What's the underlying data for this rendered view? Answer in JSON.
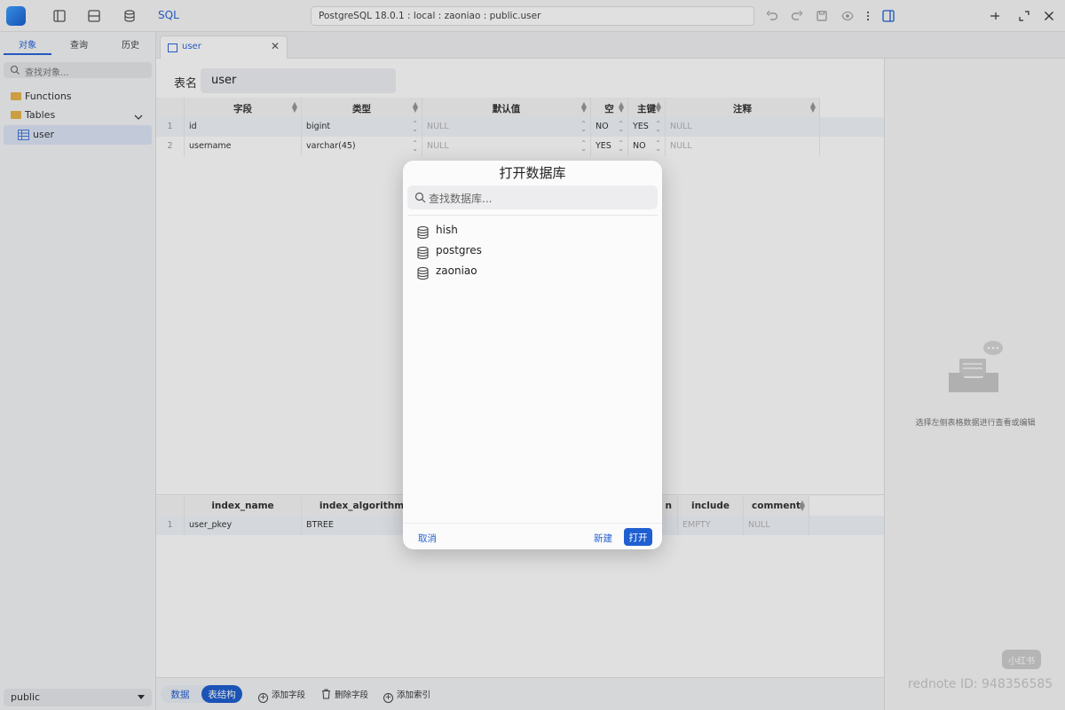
{
  "toolbar": {
    "sql_label": "SQL",
    "connection": "PostgreSQL 18.0.1 : local : zaoniao : public.user"
  },
  "sidebar": {
    "tabs": [
      "对象",
      "查询",
      "历史"
    ],
    "search_placeholder": "查找对象...",
    "tree": [
      {
        "label": "Functions"
      },
      {
        "label": "Tables"
      },
      {
        "label": "user"
      }
    ],
    "schema": "public"
  },
  "editor": {
    "tab_label": "user",
    "table_name_label": "表名",
    "table_name": "user",
    "columns": {
      "headers": [
        "字段",
        "类型",
        "默认值",
        "空",
        "主键",
        "注释"
      ],
      "rows": [
        {
          "num": "1",
          "field": "id",
          "type": "bigint",
          "default": "NULL",
          "nullable": "NO",
          "pk": "YES",
          "comment": "NULL"
        },
        {
          "num": "2",
          "field": "username",
          "type": "varchar(45)",
          "default": "NULL",
          "nullable": "YES",
          "pk": "NO",
          "comment": "NULL"
        }
      ]
    },
    "indexes": {
      "headers": [
        "index_name",
        "index_algorithm",
        "n",
        "include",
        "comment"
      ],
      "rows": [
        {
          "num": "1",
          "name": "user_pkey",
          "algorithm": "BTREE",
          "include": "EMPTY",
          "comment": "NULL"
        }
      ]
    }
  },
  "bottombar": {
    "mode_data": "数据",
    "mode_structure": "表结构",
    "add_field": "添加字段",
    "delete_field": "删除字段",
    "add_index": "添加索引"
  },
  "rightpanel": {
    "empty_text": "选择左侧表格数据进行查看或编辑",
    "watermark_logo": "小红书",
    "watermark_text": "rednote ID: 948356585"
  },
  "modal": {
    "title": "打开数据库",
    "search_placeholder": "查找数据库...",
    "databases": [
      "hish",
      "postgres",
      "zaoniao"
    ],
    "cancel": "取消",
    "new": "新建",
    "open": "打开"
  },
  "colors": {
    "accent": "#1f5fd1",
    "folder": "#e7b44a"
  }
}
